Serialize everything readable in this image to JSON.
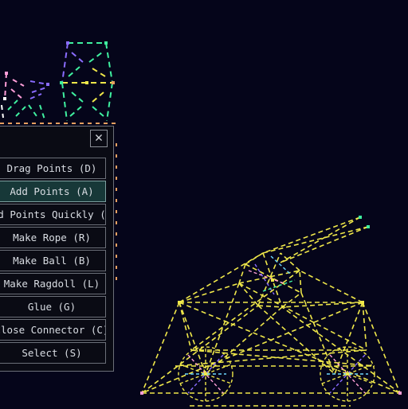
{
  "panel": {
    "close_label": "✕",
    "tools": [
      {
        "label": "Drag Points (D)",
        "active": false
      },
      {
        "label": "Add Points (A)",
        "active": true
      },
      {
        "label": "Add Points Quickly (Q)",
        "active": false
      },
      {
        "label": "Make Rope (R)",
        "active": false
      },
      {
        "label": "Make Ball (B)",
        "active": false
      },
      {
        "label": "Make Ragdoll (L)",
        "active": false
      },
      {
        "label": "Glue (G)",
        "active": false
      },
      {
        "label": "Close Connector (C)",
        "active": false
      },
      {
        "label": "Select (S)",
        "active": false
      }
    ]
  },
  "colors": {
    "background": "#05051a",
    "panel_bg": "#0a0b14",
    "panel_border": "#6b6f78",
    "active_bg": "#173838",
    "connector_yellow": "#f0e84a",
    "connector_pink": "#ff9ed8",
    "connector_purple": "#8a6cff",
    "connector_green": "#3ff0a0",
    "point_orange": "#e8a060"
  }
}
